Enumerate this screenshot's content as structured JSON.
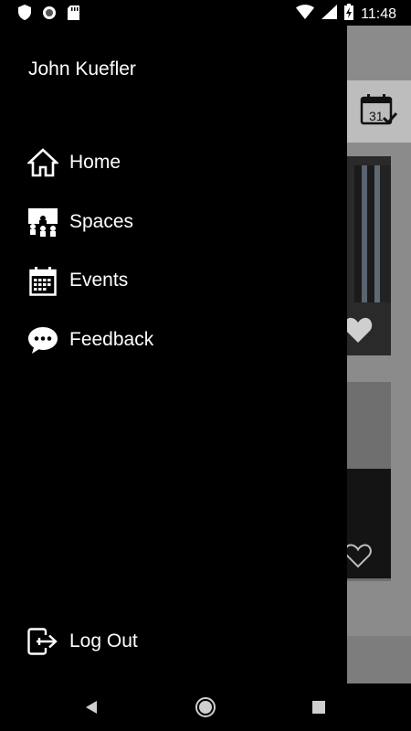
{
  "status_bar": {
    "time": "11:48",
    "left_icons": [
      "shield-icon",
      "sync-circle-icon",
      "sd-card-icon"
    ],
    "right_icons": [
      "wifi-icon",
      "cell-signal-icon",
      "battery-charging-icon"
    ]
  },
  "drawer": {
    "user_name": "John Kuefler",
    "items": [
      {
        "label": "Home",
        "icon": "home-icon"
      },
      {
        "label": "Spaces",
        "icon": "spaces-icon"
      },
      {
        "label": "Events",
        "icon": "calendar-icon"
      },
      {
        "label": "Feedback",
        "icon": "chat-bubble-icon"
      }
    ],
    "logout_label": "Log Out"
  },
  "background": {
    "calendar_day": "31"
  },
  "nav_bar": {
    "buttons": [
      "back-button",
      "home-button",
      "recents-button"
    ]
  }
}
